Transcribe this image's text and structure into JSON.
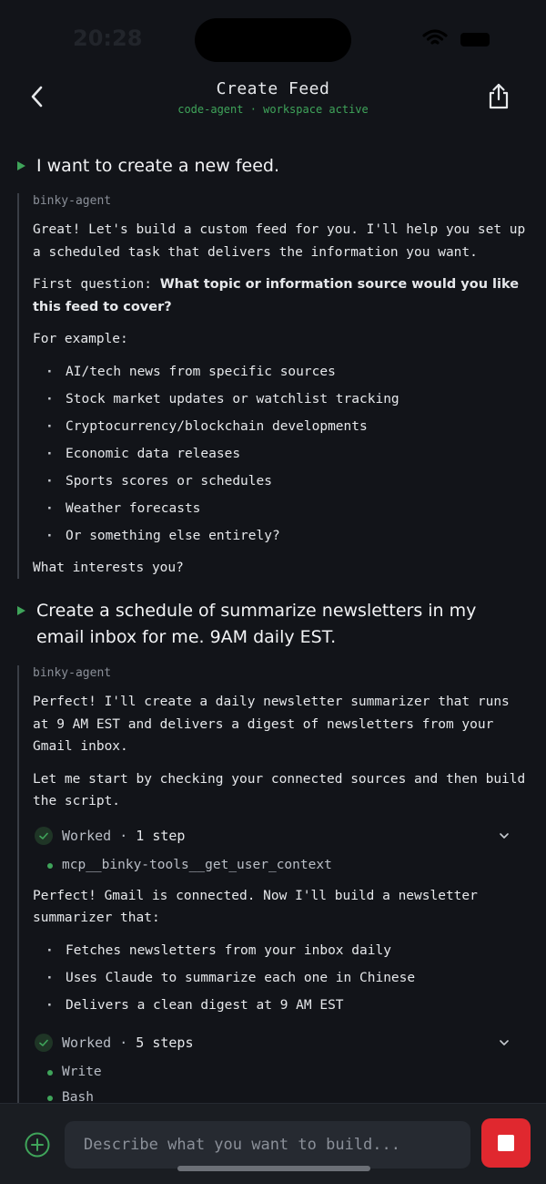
{
  "status": {
    "time": "20:28"
  },
  "header": {
    "title": "Create Feed",
    "subtitle": "code-agent · workspace active"
  },
  "messages": {
    "user1": "I want to create a new feed.",
    "agent1": {
      "name": "binky-agent",
      "intro": "Great! Let's build a custom feed for you. I'll help you set up a scheduled task that delivers the information you want.",
      "question_prefix": "First question:",
      "question_bold": "What topic or information source would you like this feed to cover?",
      "example_label": "For example:",
      "examples": [
        "AI/tech news from specific sources",
        "Stock market updates or watchlist tracking",
        "Cryptocurrency/blockchain developments",
        "Economic data releases",
        "Sports scores or schedules",
        "Weather forecasts",
        "Or something else entirely?"
      ],
      "closing": "What interests you?"
    },
    "user2": "Create a schedule of summarize newsletters in my email inbox for me. 9AM daily EST.",
    "agent2": {
      "name": "binky-agent",
      "intro": "Perfect! I'll create a daily newsletter summarizer that runs at 9 AM EST and delivers a digest of newsletters from your Gmail inbox.",
      "para2": "Let me start by checking your connected sources and then build the script.",
      "worked1": {
        "label": "Worked",
        "steps": "1 step",
        "items": [
          "mcp__binky-tools__get_user_context"
        ]
      },
      "para3": "Perfect! Gmail is connected. Now I'll build a newsletter summarizer that:",
      "bullets": [
        "Fetches newsletters from your inbox daily",
        "Uses Claude to summarize each one in Chinese",
        "Delivers a clean digest at 9 AM EST"
      ],
      "worked2": {
        "label": "Worked",
        "steps": "5 steps",
        "items": [
          "Write",
          "Bash"
        ]
      }
    }
  },
  "composer": {
    "placeholder": "Describe what you want to build..."
  },
  "colors": {
    "accent": "#3fa45a",
    "stop": "#e0282f",
    "background": "#121419"
  }
}
